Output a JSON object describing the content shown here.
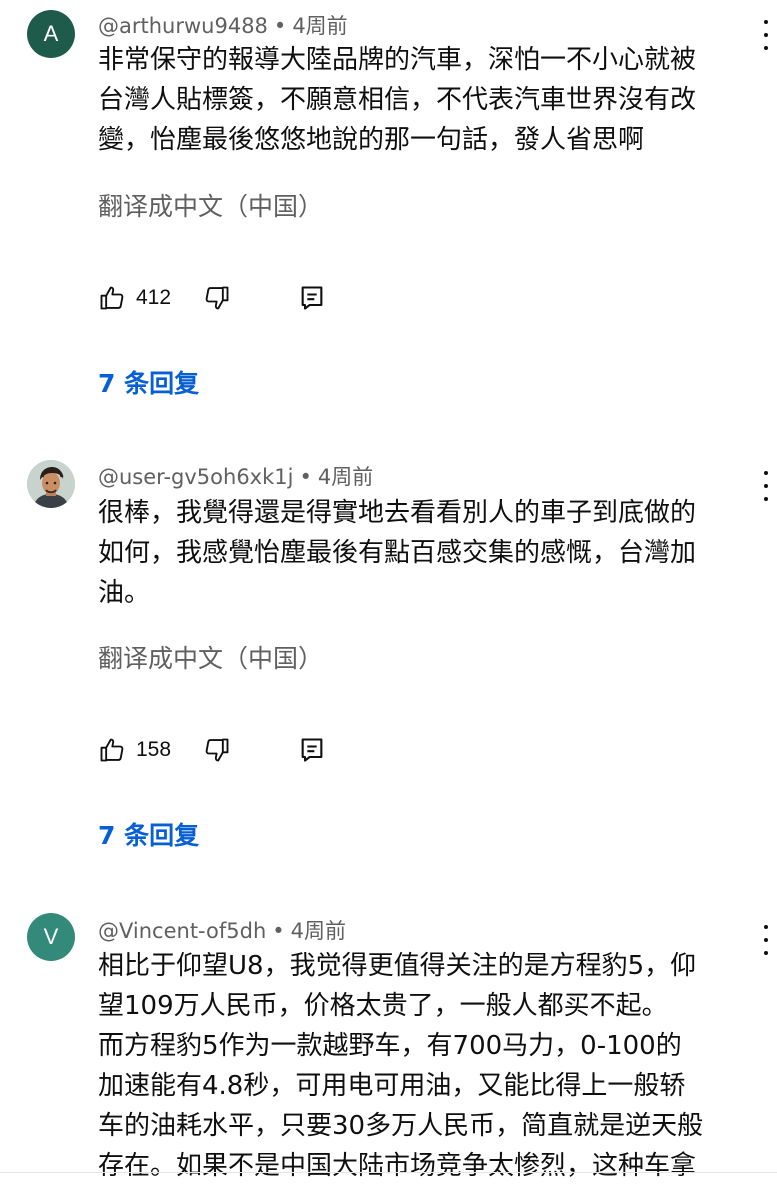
{
  "comments": [
    {
      "avatar_letter": "A",
      "author": "@arthurwu9488",
      "time": "4周前",
      "lines": [
        "非常保守的報導大陸品牌的汽車，深怕一不小心就被",
        "台灣人貼標簽，不願意相信，不代表汽車世界沒有改",
        "變，怡塵最後悠悠地說的那一句話，發人省思啊"
      ],
      "translate_label": "翻译成中文（中国）",
      "likes": "412",
      "replies_label": "7 条回复"
    },
    {
      "avatar_letter": "",
      "author": "@user-gv5oh6xk1j",
      "time": "4周前",
      "lines": [
        "很棒，我覺得還是得實地去看看別人的車子到底做的",
        "如何，我感覺怡塵最後有點百感交集的感慨，台灣加",
        "油。"
      ],
      "translate_label": "翻译成中文（中国）",
      "likes": "158",
      "replies_label": "7 条回复"
    },
    {
      "avatar_letter": "V",
      "author": "@Vincent-of5dh",
      "time": "4周前",
      "lines": [
        "相比于仰望U8，我觉得更值得关注的是方程豹5，仰",
        "望109万人民币，价格太贵了，一般人都买不起。",
        "而方程豹5作为一款越野车，有700马力，0-100的",
        "加速能有4.8秒，可用电可用油，又能比得上一般轿",
        "车的油耗水平，只要30多万人民币，简直就是逆天般",
        "存在。如果不是中国大陆市场竞争太惨烈，这种车拿"
      ]
    }
  ],
  "separator": "•",
  "colors": {
    "link_blue": "#065fd4",
    "meta_gray": "#606060",
    "avatar_a": "#1f5b4a",
    "avatar_v": "#33897a"
  },
  "icons": {
    "like": "thumbs-up-icon",
    "dislike": "thumbs-down-icon",
    "reply": "reply-icon",
    "more": "more-vertical-icon"
  }
}
